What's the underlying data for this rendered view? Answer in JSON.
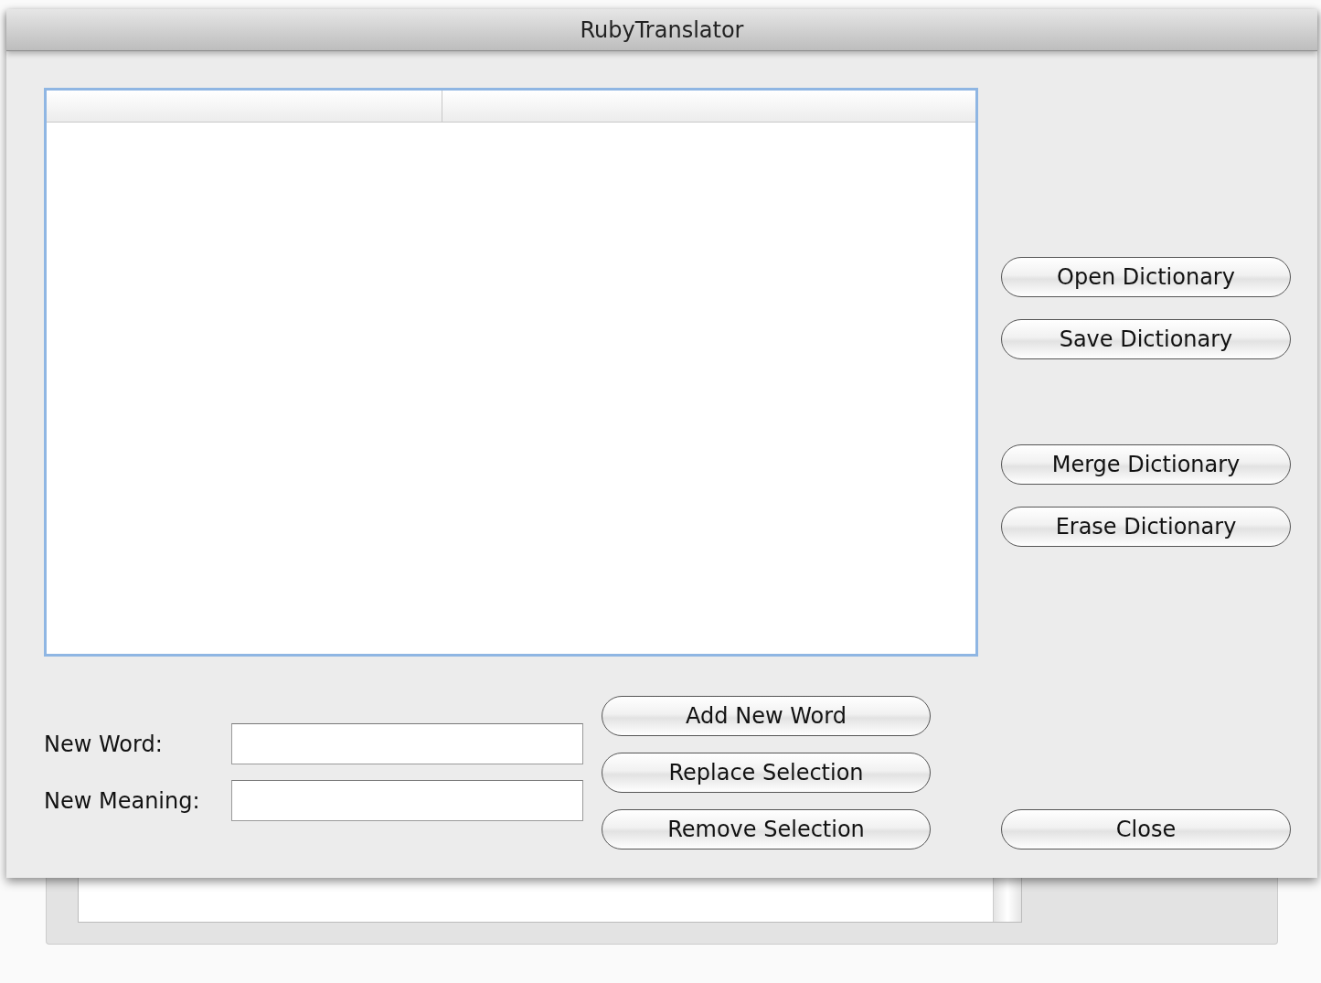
{
  "window": {
    "title": "RubyTranslator"
  },
  "dictionary_button_groups": [
    [
      "Open Dictionary",
      "Save Dictionary"
    ],
    [
      "Merge Dictionary",
      "Erase Dictionary"
    ]
  ],
  "form": {
    "fields": [
      {
        "label": "New Word:"
      },
      {
        "label": "New Meaning:"
      }
    ]
  },
  "word_buttons": [
    {
      "label": "Add New Word"
    },
    {
      "label": "Replace Selection"
    },
    {
      "label": "Remove Selection"
    }
  ],
  "close_button": {
    "label": "Close"
  }
}
